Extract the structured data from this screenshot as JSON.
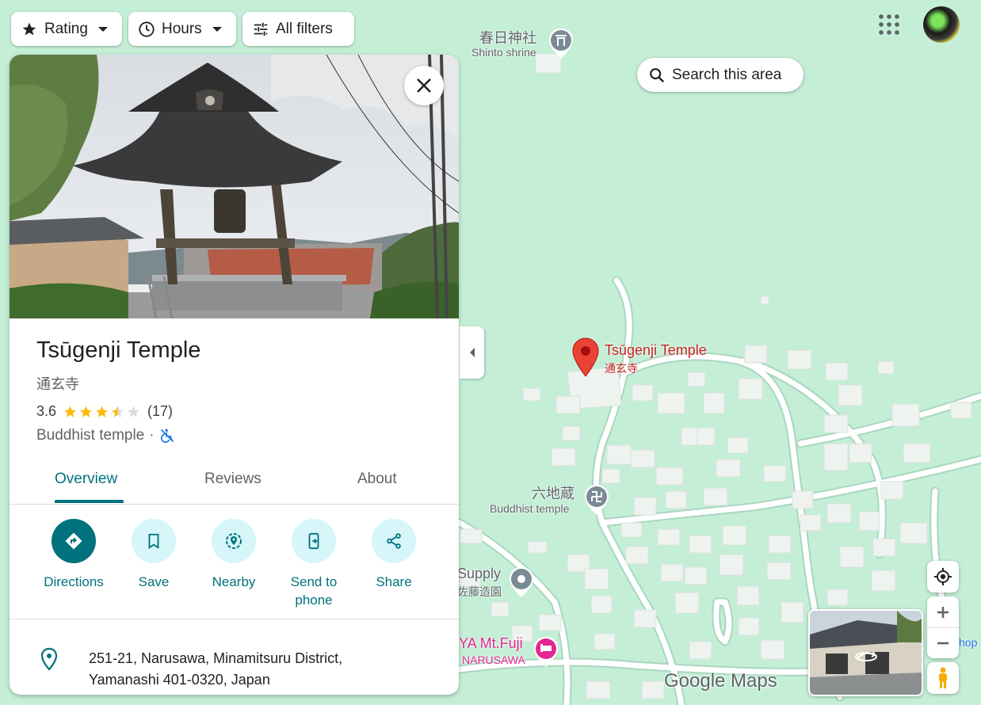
{
  "filters": {
    "rating_label": "Rating",
    "hours_label": "Hours",
    "all_filters_label": "All filters"
  },
  "search_area_label": "Search this area",
  "place": {
    "name": "Tsūgenji Temple",
    "native_name": "通玄寺",
    "rating": "3.6",
    "rating_value": 3.6,
    "review_count": "(17)",
    "category": "Buddhist temple",
    "separator": "·"
  },
  "tabs": [
    {
      "label": "Overview",
      "active": true
    },
    {
      "label": "Reviews",
      "active": false
    },
    {
      "label": "About",
      "active": false
    }
  ],
  "actions": [
    {
      "label": "Directions",
      "icon": "directions-icon"
    },
    {
      "label": "Save",
      "icon": "bookmark-icon"
    },
    {
      "label": "Nearby",
      "icon": "nearby-icon"
    },
    {
      "label": "Send to phone",
      "icon": "send-to-phone-icon"
    },
    {
      "label": "Share",
      "icon": "share-icon"
    }
  ],
  "address": {
    "line1": "251-21, Narusawa, Minamitsuru District,",
    "line2": "Yamanashi 401-0320, Japan"
  },
  "map": {
    "shrine": {
      "name": "春日神社",
      "type": "Shinto shrine"
    },
    "selected": {
      "name": "Tsūgenji Temple",
      "native": "通玄寺"
    },
    "rokujizo": {
      "name": "六地蔵",
      "type": "Buddhist temple"
    },
    "supply": {
      "name": "Supply",
      "native": "佐藤造園"
    },
    "hotel": {
      "name": "YA Mt.Fuji",
      "sub": "NARUSAWA"
    },
    "edge_label": "shop",
    "logo": "Google Maps"
  },
  "colors": {
    "accent": "#00727d",
    "map_bg": "#c4efd6",
    "pin_red": "#ea4335",
    "hotel_pink": "#e52592"
  }
}
